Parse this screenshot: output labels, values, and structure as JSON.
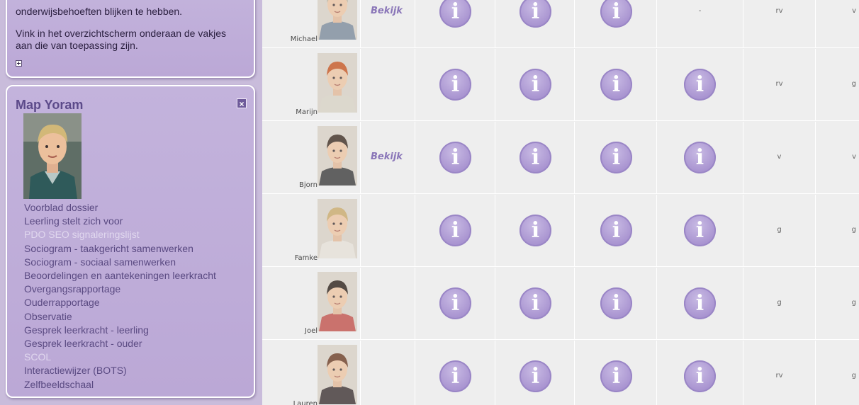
{
  "sidebar": {
    "top_panel": {
      "line1": "onderwijsbehoeften blijken te hebben.",
      "line2": "Vink in het overzichtscherm onderaan de vakjes aan die van toepassing zijn."
    },
    "map_panel": {
      "title": "Map Yoram",
      "close_icon": "×",
      "links": [
        {
          "label": "Voorblad dossier",
          "faded": false
        },
        {
          "label": "Leerling stelt zich voor",
          "faded": false
        },
        {
          "label": "PDO SEO signaleringslijst",
          "faded": true
        },
        {
          "label": "Sociogram - taakgericht samenwerken",
          "faded": false
        },
        {
          "label": "Sociogram - sociaal samenwerken",
          "faded": false
        },
        {
          "label": "Beoordelingen en aantekeningen leerkracht",
          "faded": false
        },
        {
          "label": "Overgangsrapportage",
          "faded": false
        },
        {
          "label": "Ouderrapportage",
          "faded": false
        },
        {
          "label": "Observatie",
          "faded": false
        },
        {
          "label": "Gesprek leerkracht - leerling",
          "faded": false
        },
        {
          "label": "Gesprek leerkracht - ouder",
          "faded": false
        },
        {
          "label": "SCOL",
          "faded": true
        },
        {
          "label": "Interactiewijzer (BOTS)",
          "faded": false
        },
        {
          "label": "Zelfbeeldschaal",
          "faded": false
        }
      ]
    }
  },
  "table": {
    "info_glyph": "i",
    "rows": [
      {
        "name": "Michael",
        "view_link": "Bekijk",
        "info": [
          true,
          true,
          true,
          false
        ],
        "dash": "-",
        "grade1": "rv",
        "grade2": "v",
        "hair": "#b9b09a",
        "shirt": "#7a8a9a"
      },
      {
        "name": "Marijn",
        "view_link": "",
        "info": [
          true,
          true,
          true,
          true
        ],
        "dash": "",
        "grade1": "rv",
        "grade2": "g",
        "hair": "#c4541f",
        "shirt": "#d8d2c4"
      },
      {
        "name": "Bjorn",
        "view_link": "Bekijk",
        "info": [
          true,
          true,
          true,
          true
        ],
        "dash": "",
        "grade1": "v",
        "grade2": "v",
        "hair": "#3a2a1e",
        "shirt": "#3a3a3a"
      },
      {
        "name": "Famke",
        "view_link": "",
        "info": [
          true,
          true,
          true,
          true
        ],
        "dash": "",
        "grade1": "g",
        "grade2": "g",
        "hair": "#c8a868",
        "shirt": "#e6e1d8"
      },
      {
        "name": "Joel",
        "view_link": "",
        "info": [
          true,
          true,
          true,
          true
        ],
        "dash": "",
        "grade1": "g",
        "grade2": "g",
        "hair": "#2a1e16",
        "shirt": "#c0504a"
      },
      {
        "name": "Lauren",
        "view_link": "",
        "info": [
          true,
          true,
          true,
          true
        ],
        "dash": "",
        "grade1": "rv",
        "grade2": "g",
        "hair": "#6a3a22",
        "shirt": "#3a3030"
      }
    ]
  },
  "colors": {
    "sidebar_bg": "#c9bcdb",
    "panel_bg": "#bba8d6",
    "link_color": "#5a4a82",
    "title_color": "#5c4a8a",
    "info_icon": "#a893d0"
  }
}
